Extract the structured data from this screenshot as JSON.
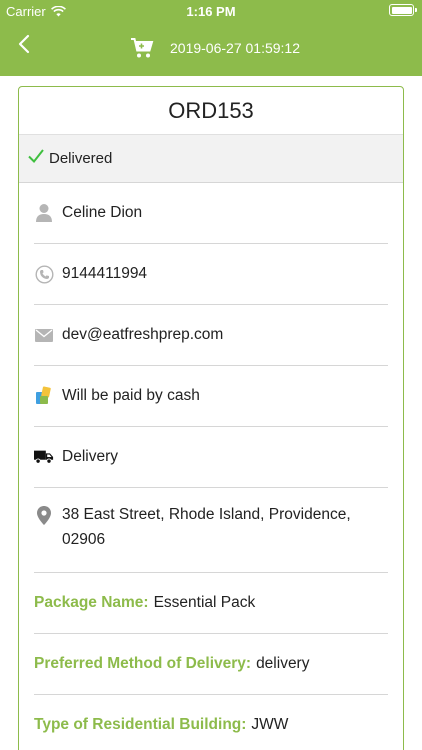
{
  "status_bar": {
    "carrier": "Carrier",
    "time": "1:16 PM"
  },
  "header": {
    "timestamp": "2019-06-27 01:59:12"
  },
  "order": {
    "id": "ORD153",
    "status": "Delivered",
    "customer_name": "Celine Dion",
    "phone": "9144411994",
    "email": "dev@eatfreshprep.com",
    "payment": "Will be paid by cash",
    "delivery_type": "Delivery",
    "address": "38 East Street, Rhode Island, Providence, 02906"
  },
  "details": [
    {
      "label": "Package Name:",
      "value": "Essential Pack"
    },
    {
      "label": "Preferred Method of Delivery:",
      "value": "delivery"
    },
    {
      "label": "Type of Residential Building:",
      "value": "JWW"
    }
  ],
  "colors": {
    "accent": "#8dbb4b",
    "check": "#3fbf3f",
    "icon_gray": "#a8a8a8"
  },
  "icons": [
    "back-chevron-icon",
    "cart-icon",
    "checkmark-icon",
    "person-icon",
    "phone-icon",
    "envelope-icon",
    "payment-icon",
    "truck-icon",
    "location-pin-icon"
  ]
}
